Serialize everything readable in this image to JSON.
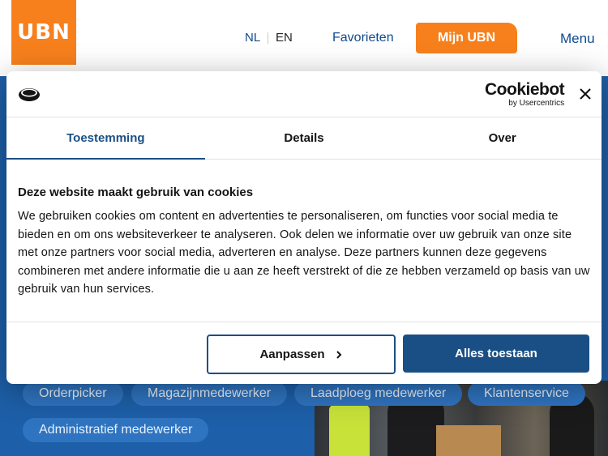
{
  "site": {
    "logo_text": "UBN",
    "lang_nl": "NL",
    "lang_en": "EN",
    "favorites": "Favorieten",
    "my_account": "Mijn UBN",
    "menu": "Menu",
    "tags": [
      "Orderpicker",
      "Magazijnmedewerker",
      "Laadploeg medewerker",
      "Klantenservice",
      "Administratief medewerker"
    ],
    "colors": {
      "brand_orange": "#f7801d",
      "brand_blue": "#0f4a8c",
      "tag_blue": "#2f74c0"
    }
  },
  "dialog": {
    "brand_main": "Cookiebot",
    "brand_sub": "by Usercentrics",
    "tabs": [
      "Toestemming",
      "Details",
      "Over"
    ],
    "active_tab": "Toestemming",
    "title": "Deze website maakt gebruik van cookies",
    "text": "We gebruiken cookies om content en advertenties te personaliseren, om functies voor social media te bieden en om ons websiteverkeer te analyseren. Ook delen we informatie over uw gebruik van onze site met onze partners voor social media, adverteren en analyse. Deze partners kunnen deze gegevens combineren met andere informatie die u aan ze heeft verstrekt of die ze hebben verzameld op basis van uw gebruik van hun services.",
    "customize_label": "Aanpassen",
    "allow_all_label": "Alles toestaan",
    "icons": {
      "cookie": "cookie-icon",
      "close": "close-icon",
      "chevron": "chevron-right-icon"
    },
    "colors": {
      "accent": "#1a4f85"
    }
  }
}
